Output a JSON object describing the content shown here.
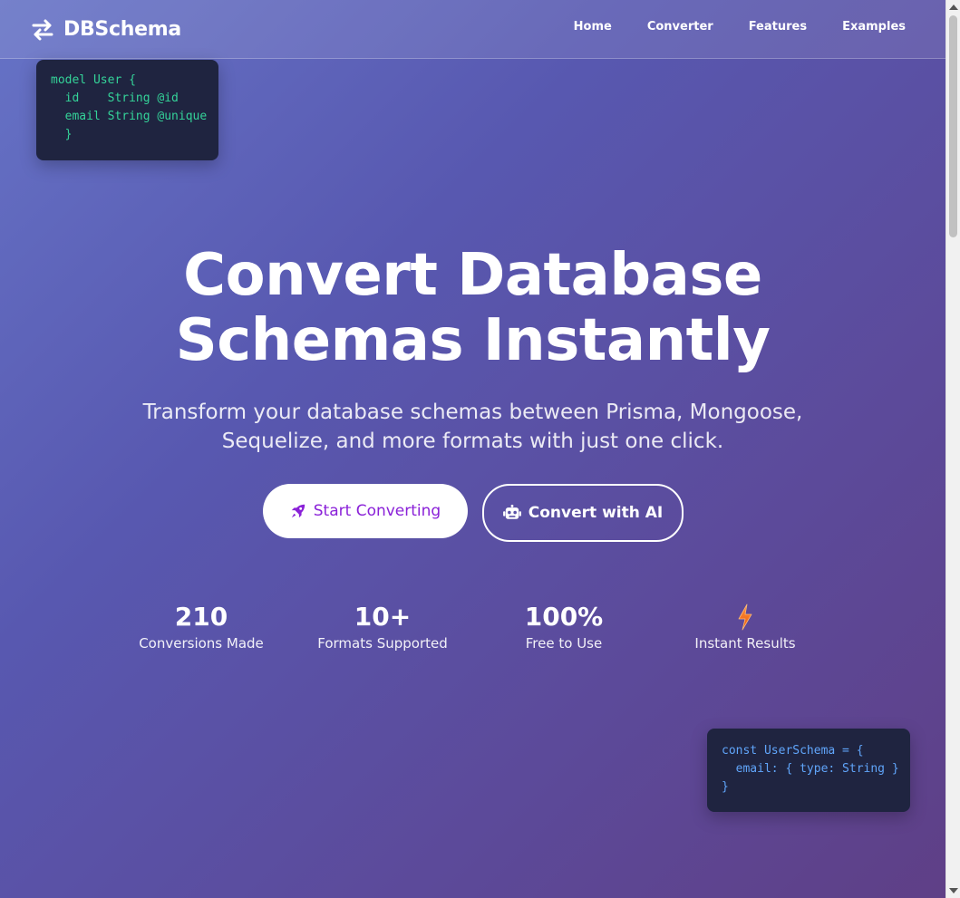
{
  "header": {
    "brand_name": "DBSchema",
    "brand_icon": "exchange-arrows-icon",
    "nav": [
      {
        "label": "Home"
      },
      {
        "label": "Converter"
      },
      {
        "label": "Features"
      },
      {
        "label": "Examples"
      }
    ]
  },
  "code_samples": {
    "prisma": [
      "model User {",
      "  id    String @id",
      "  email String @unique",
      "  }"
    ],
    "mongoose": [
      "const UserSchema = {",
      "  email: { type: String }",
      "}"
    ]
  },
  "hero": {
    "title_line_1": "Convert Database",
    "title_line_2": "Schemas Instantly",
    "subtitle_line_1": "Transform your database schemas between Prisma, Mongoose,",
    "subtitle_line_2": "Sequelize, and more formats with just one click.",
    "primary_button": {
      "label": "Start Converting",
      "icon": "rocket-icon"
    },
    "secondary_button": {
      "label": "Convert with AI",
      "icon": "robot-icon"
    }
  },
  "stats": [
    {
      "value": "210",
      "label": "Conversions Made"
    },
    {
      "value": "10+",
      "label": "Formats Supported"
    },
    {
      "value": "100%",
      "label": "Free to Use"
    },
    {
      "value": "",
      "label": "Instant Results",
      "icon": "lightning-bolt-icon"
    }
  ],
  "colors": {
    "accent_purple": "#8a21d8",
    "prisma_code": "#34d399",
    "mongoose_code": "#60a5fa",
    "code_background": "#1f2440",
    "bolt_orange": "#f97316"
  }
}
